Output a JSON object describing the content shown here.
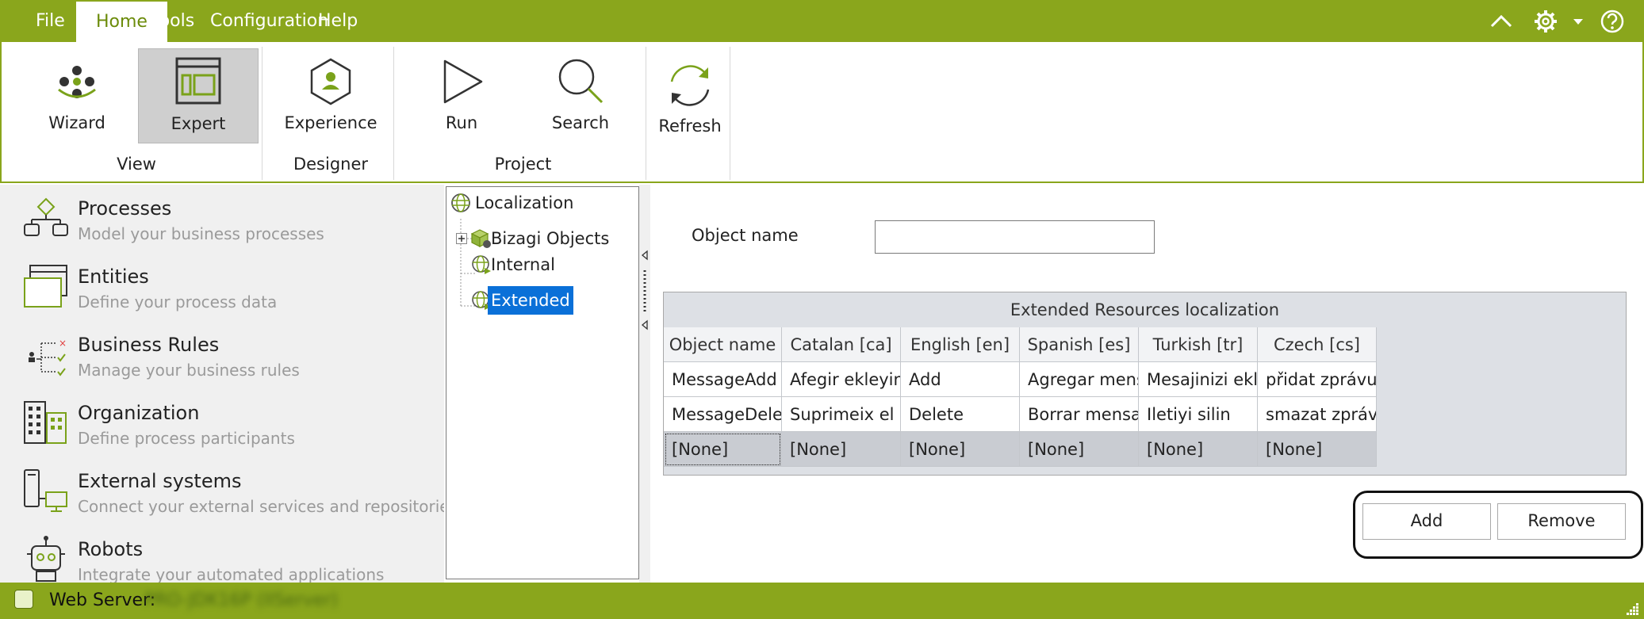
{
  "menubar": {
    "items": [
      "File",
      "Home",
      "Tools",
      "Configuration",
      "Help"
    ],
    "active": "Home",
    "icons": [
      "collapse-ribbon-icon",
      "gear-icon",
      "dropdown-arrow-icon",
      "help-icon"
    ]
  },
  "ribbon": {
    "buttons": {
      "wizard": "Wizard",
      "expert": "Expert",
      "experience": "Experience",
      "run": "Run",
      "search": "Search",
      "refresh": "Refresh"
    },
    "groups": {
      "view": "View",
      "designer": "Designer",
      "project": "Project"
    }
  },
  "nav": {
    "items": [
      {
        "title": "Processes",
        "subtitle": "Model your business processes",
        "icon": "process-flow-icon"
      },
      {
        "title": "Entities",
        "subtitle": "Define your process data",
        "icon": "entities-icon"
      },
      {
        "title": "Business Rules",
        "subtitle": "Manage your business rules",
        "icon": "business-rules-icon"
      },
      {
        "title": "Organization",
        "subtitle": "Define process participants",
        "icon": "organization-icon"
      },
      {
        "title": "External systems",
        "subtitle": "Connect your external services and repositories",
        "icon": "external-systems-icon"
      },
      {
        "title": "Robots",
        "subtitle": "Integrate your automated applications",
        "icon": "robot-icon"
      }
    ]
  },
  "tree": {
    "root": "Localization",
    "children": [
      "Bizagi Objects",
      "Internal",
      "Extended"
    ],
    "selected": "Extended"
  },
  "content": {
    "object_name_label": "Object name",
    "object_name_value": "",
    "grid": {
      "caption": "Extended Resources localization",
      "columns": [
        "Object name",
        "Catalan [ca]",
        "English [en]",
        "Spanish [es]",
        "Turkish [tr]",
        "Czech [cs]"
      ],
      "rows": [
        [
          "MessageAdd",
          "Afegir ekleyin",
          "Add",
          "Agregar mensaje",
          "Mesajinizi ekleyin",
          " přidat zprávu"
        ],
        [
          "MessageDelete",
          "Suprimeix el mix",
          "Delete",
          "Borrar mensaje",
          "Iletiyi silin",
          "smazat zprávu"
        ],
        [
          "[None]",
          "[None]",
          "[None]",
          "[None]",
          "[None]",
          "[None]"
        ]
      ]
    },
    "buttons": {
      "add": "Add",
      "remove": "Remove"
    }
  },
  "status": {
    "label": "Web Server:",
    "value": "PRO-JDK16P (IIServer)"
  },
  "colors": {
    "brand": "#8aa61c",
    "selection": "#0a70d8",
    "icon_green": "#7aa21a"
  }
}
